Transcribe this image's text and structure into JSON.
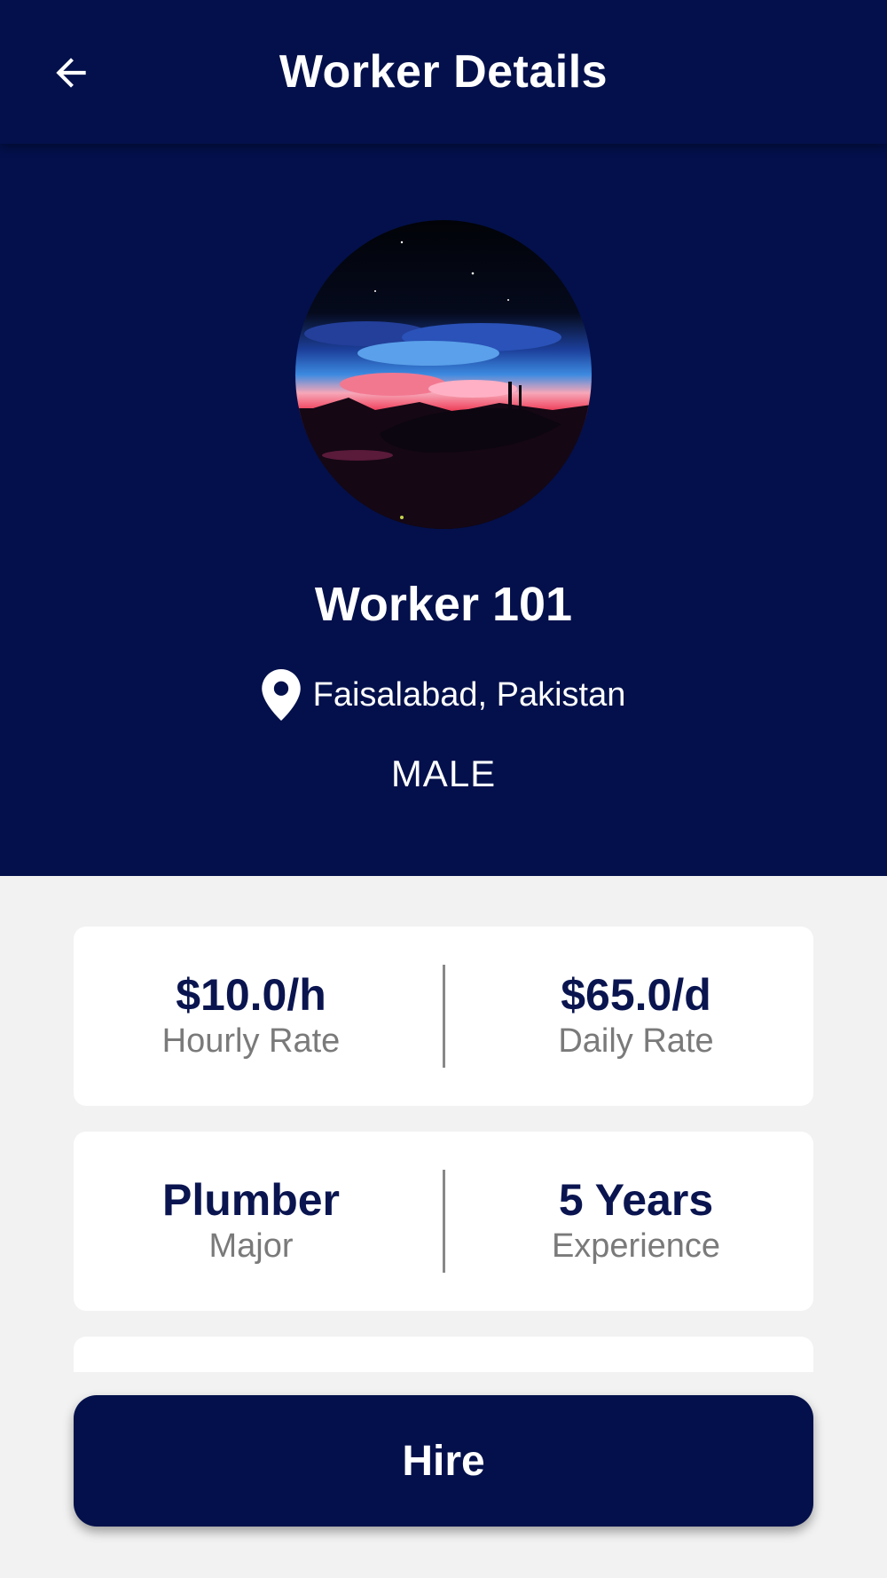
{
  "colors": {
    "primary": "#03104b",
    "background": "#f2f2f2",
    "card": "#ffffff",
    "value_text": "#0a1550",
    "label_text": "#7a7a7a"
  },
  "appbar": {
    "title": "Worker Details",
    "back_icon": "arrow-left-icon"
  },
  "profile": {
    "avatar": "night-sky-landscape-avatar",
    "name": "Worker 101",
    "location_icon": "map-pin-icon",
    "location": "Faisalabad, Pakistan",
    "gender": "MALE"
  },
  "rates": {
    "hourly_value": "$10.0/h",
    "hourly_label": "Hourly Rate",
    "daily_value": "$65.0/d",
    "daily_label": "Daily Rate"
  },
  "profession": {
    "major_value": "Plumber",
    "major_label": "Major",
    "experience_value": "5 Years",
    "experience_label": "Experience"
  },
  "actions": {
    "hire_label": "Hire"
  }
}
